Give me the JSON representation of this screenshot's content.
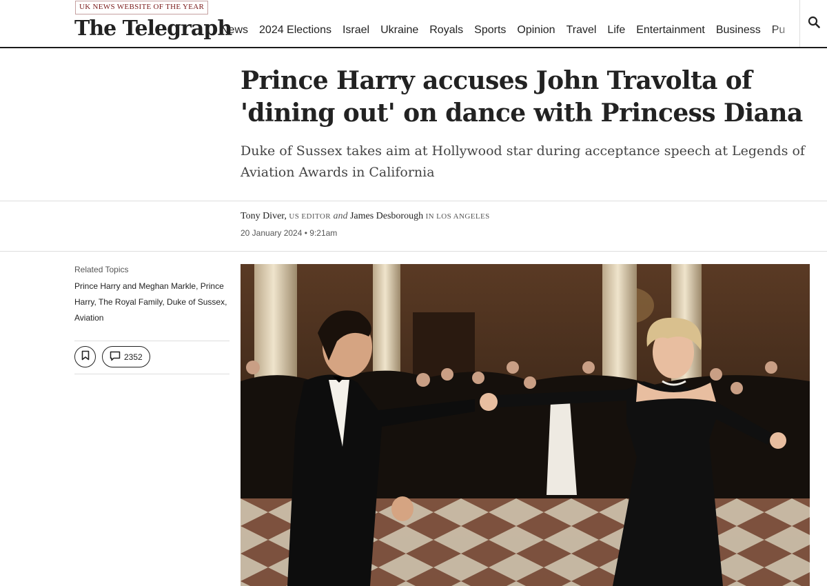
{
  "header": {
    "award_badge": "UK NEWS WEBSITE OF THE YEAR",
    "masthead": "The Telegraph",
    "nav": [
      {
        "label": "News"
      },
      {
        "label": "2024 Elections"
      },
      {
        "label": "Israel"
      },
      {
        "label": "Ukraine"
      },
      {
        "label": "Royals"
      },
      {
        "label": "Sports"
      },
      {
        "label": "Opinion"
      },
      {
        "label": "Travel"
      },
      {
        "label": "Life"
      },
      {
        "label": "Entertainment"
      },
      {
        "label": "Business"
      },
      {
        "label": "Pu"
      }
    ],
    "search_icon": "search-icon"
  },
  "article": {
    "headline": "Prince Harry accuses John Travolta of 'dining out' on dance with Princess Diana",
    "standfirst": "Duke of Sussex takes aim at Hollywood star during acceptance speech at Legends of Aviation Awards in California",
    "byline": {
      "author1": "Tony Diver,",
      "role1": "US EDITOR",
      "conjunction": "and",
      "author2": "James Desborough",
      "role2": "IN LOS ANGELES"
    },
    "date": "20 January 2024 • 9:21am"
  },
  "sidebar": {
    "related_heading": "Related Topics",
    "related_topics": [
      {
        "label": "Prince Harry and Meghan Markle"
      },
      {
        "label": "Prince Harry"
      },
      {
        "label": "The Royal Family"
      },
      {
        "label": "Duke of Sussex"
      },
      {
        "label": "Aviation"
      }
    ],
    "bookmark_icon": "bookmark-icon",
    "comment_icon": "comment-icon",
    "comment_count": "2352"
  },
  "colors": {
    "text": "#222222",
    "award": "#7a1b1b",
    "divider": "#dddddd"
  }
}
